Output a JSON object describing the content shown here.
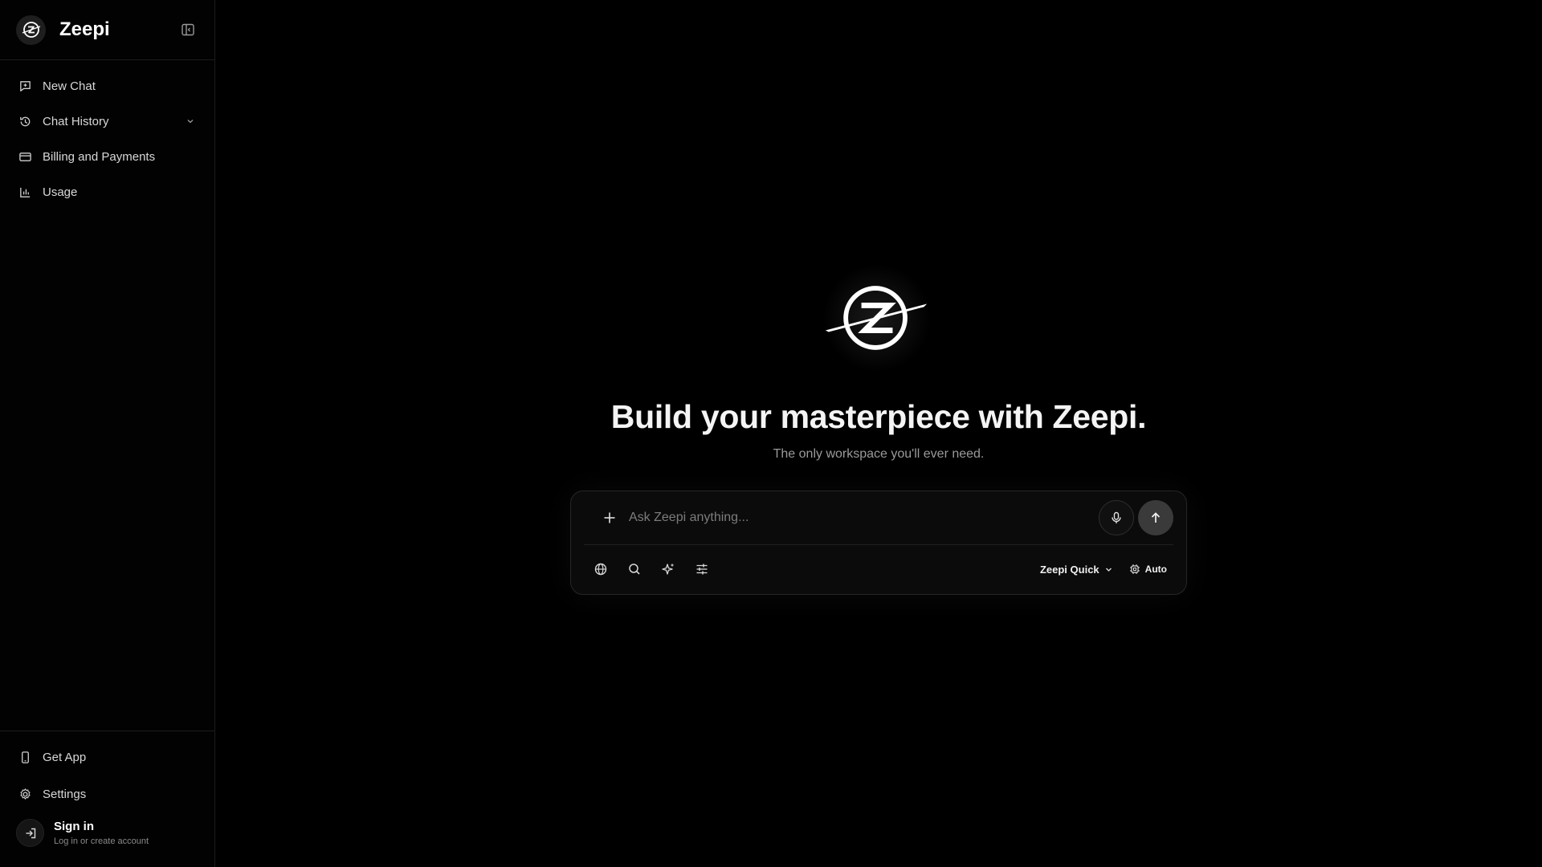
{
  "sidebar": {
    "brand": "Zeepi",
    "nav": [
      {
        "label": "New Chat",
        "icon": "new-chat-icon"
      },
      {
        "label": "Chat History",
        "icon": "history-icon",
        "expandable": true
      },
      {
        "label": "Billing and Payments",
        "icon": "credit-card-icon"
      },
      {
        "label": "Usage",
        "icon": "bar-chart-icon"
      }
    ],
    "footer": [
      {
        "label": "Get App",
        "icon": "phone-icon"
      },
      {
        "label": "Settings",
        "icon": "gear-icon"
      }
    ],
    "signin": {
      "title": "Sign in",
      "subtitle": "Log in or create account"
    }
  },
  "main": {
    "headline": "Build your masterpiece with Zeepi.",
    "subline": "The only workspace you'll ever need.",
    "composer": {
      "placeholder": "Ask Zeepi anything...",
      "model": "Zeepi Quick",
      "mode": "Auto",
      "tools": [
        "globe-icon",
        "search-icon",
        "sparkles-icon",
        "sliders-icon"
      ]
    }
  },
  "colors": {
    "background": "#000000",
    "surface": "#0b0b0b",
    "text": "#e8e8e8",
    "muted": "#9a9a9a",
    "send_button": "#3a3a3a"
  }
}
